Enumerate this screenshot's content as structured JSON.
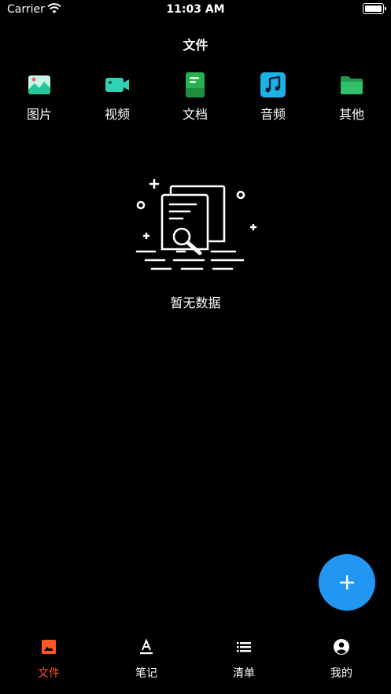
{
  "status_bar": {
    "carrier": "Carrier",
    "time": "11:03 AM",
    "battery_level": 1.0
  },
  "header": {
    "title": "文件"
  },
  "categories": [
    {
      "label": "图片",
      "icon": "image-icon",
      "color": "#22c79a"
    },
    {
      "label": "视频",
      "icon": "video-icon",
      "color": "#2fd3b4"
    },
    {
      "label": "文档",
      "icon": "document-icon",
      "color": "#25b14f"
    },
    {
      "label": "音频",
      "icon": "music-icon",
      "color": "#1fb0e8"
    },
    {
      "label": "其他",
      "icon": "folder-icon",
      "color": "#33c06a"
    }
  ],
  "empty_state": {
    "text": "暂无数据",
    "icon": "empty-documents-icon"
  },
  "fab": {
    "icon": "plus-icon",
    "color": "#2196f3"
  },
  "tabbar": {
    "active_color": "#ff5722",
    "items": [
      {
        "label": "文件",
        "icon": "image-icon",
        "active": true
      },
      {
        "label": "笔记",
        "icon": "text-icon",
        "active": false
      },
      {
        "label": "清单",
        "icon": "list-icon",
        "active": false
      },
      {
        "label": "我的",
        "icon": "account-icon",
        "active": false
      }
    ]
  }
}
